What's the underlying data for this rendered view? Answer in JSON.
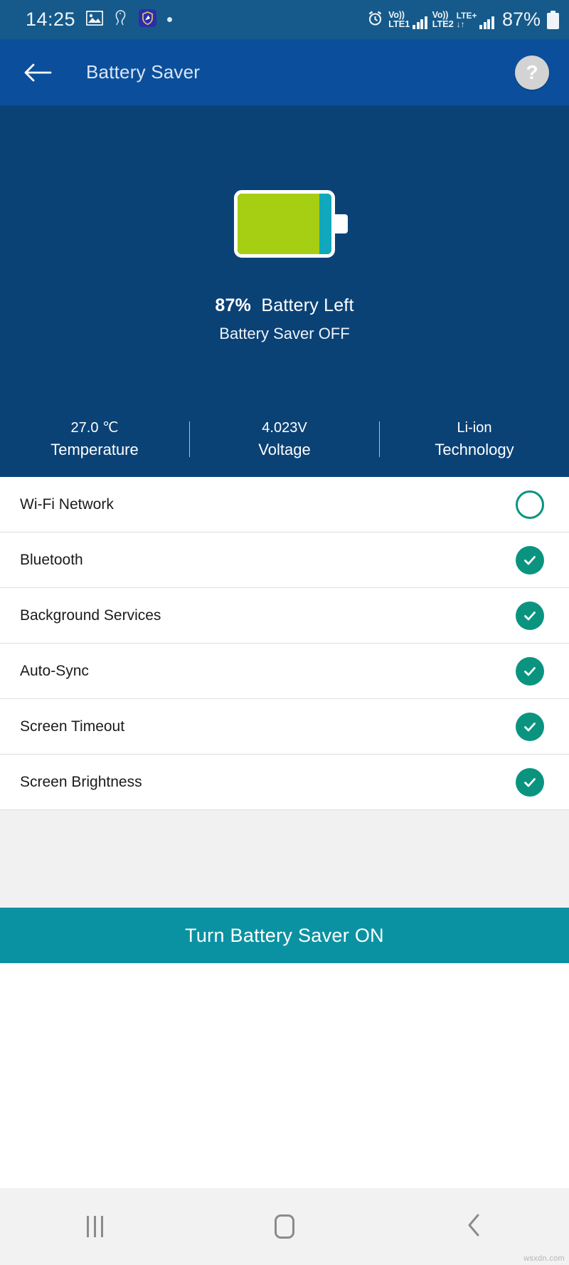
{
  "status_bar": {
    "time": "14:25",
    "icons": [
      "image-icon",
      "bird-icon",
      "shield-app-icon",
      "dot-icon"
    ],
    "alarm_icon": "alarm-icon",
    "sim1": {
      "volte": "Vo))",
      "label": "LTE1"
    },
    "sim2": {
      "volte": "Vo))",
      "label": "LTE2",
      "network": "LTE+",
      "data": "↓↑"
    },
    "battery_percent": "87%"
  },
  "app_bar": {
    "back_icon": "back-arrow-icon",
    "title": "Battery Saver",
    "help_label": "?"
  },
  "hero": {
    "battery_level": 87,
    "battery_fill_color": "#a6ce13",
    "battery_rest_color": "#11a8bd",
    "percent_text": "87%",
    "battery_left_text": "Battery Left",
    "saver_state_text": "Battery Saver OFF",
    "stats": [
      {
        "value": "27.0 ℃",
        "label": "Temperature"
      },
      {
        "value": "4.023V",
        "label": "Voltage"
      },
      {
        "value": "Li-ion",
        "label": "Technology"
      }
    ]
  },
  "options": [
    {
      "label": "Wi-Fi Network",
      "checked": false
    },
    {
      "label": "Bluetooth",
      "checked": true
    },
    {
      "label": "Background Services",
      "checked": true
    },
    {
      "label": "Auto-Sync",
      "checked": true
    },
    {
      "label": "Screen Timeout",
      "checked": true
    },
    {
      "label": "Screen Brightness",
      "checked": true
    }
  ],
  "cta": {
    "label": "Turn Battery Saver ON",
    "color": "#0b92a2"
  },
  "nav_bar": {
    "recents_icon": "recents-icon",
    "home_icon": "home-icon",
    "back_icon": "nav-back-icon"
  },
  "watermark": "wsxdn.com",
  "theme": {
    "status_bar_bg": "#155a8a",
    "app_bar_bg": "#0b4f9c",
    "hero_bg": "#0b4276",
    "accent_teal": "#0a9480"
  }
}
